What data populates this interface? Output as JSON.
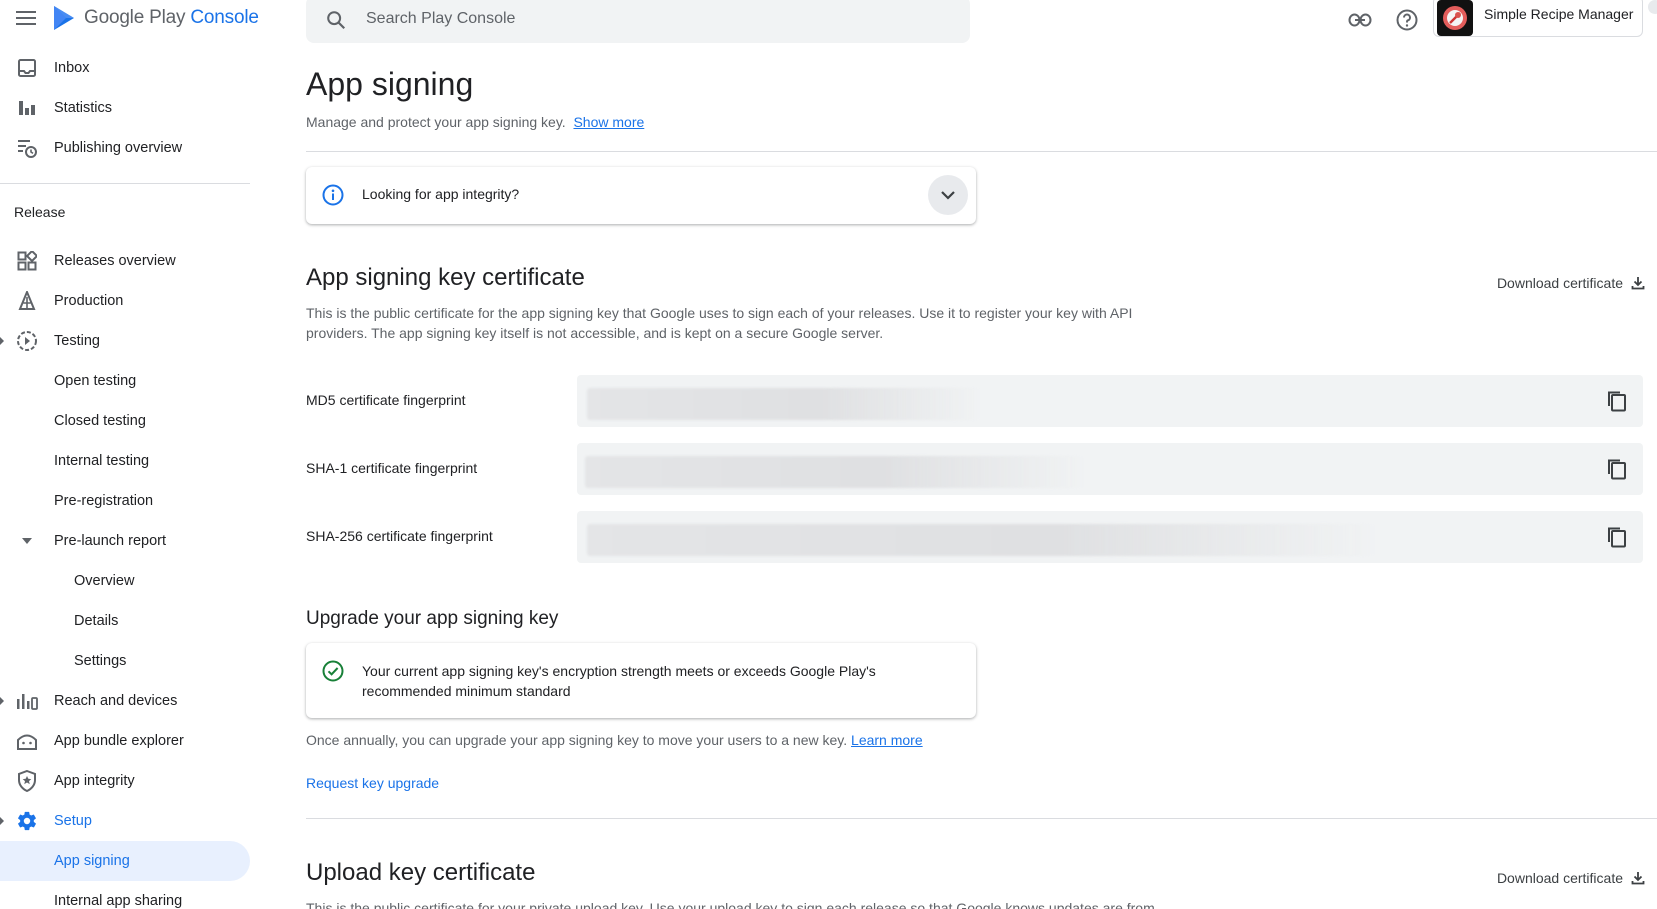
{
  "app": {
    "brand": "Google Play",
    "brand_accent": "Console",
    "accent_color": "#1a73e8"
  },
  "search": {
    "placeholder": "Search Play Console",
    "value": ""
  },
  "account": {
    "name": "Simple Recipe Manager"
  },
  "sidebar": {
    "top_items": [
      {
        "label": "Inbox",
        "icon": "inbox-icon"
      },
      {
        "label": "Statistics",
        "icon": "bar-chart-icon"
      },
      {
        "label": "Publishing overview",
        "icon": "publishing-overview-icon"
      }
    ],
    "section_label": "Release",
    "items": [
      {
        "label": "Releases overview",
        "icon": "dashboard-icon"
      },
      {
        "label": "Production",
        "icon": "production-icon"
      },
      {
        "label": "Testing",
        "icon": "testing-icon"
      },
      {
        "label": "Open testing"
      },
      {
        "label": "Closed testing"
      },
      {
        "label": "Internal testing"
      },
      {
        "label": "Pre-registration"
      },
      {
        "label": "Pre-launch report",
        "icon": "caret-down-icon"
      },
      {
        "label": "Overview"
      },
      {
        "label": "Details"
      },
      {
        "label": "Settings"
      },
      {
        "label": "Reach and devices",
        "icon": "reach-devices-icon"
      },
      {
        "label": "App bundle explorer",
        "icon": "bundle-explorer-icon"
      },
      {
        "label": "App integrity",
        "icon": "shield-icon"
      },
      {
        "label": "Setup",
        "icon": "gear-icon"
      },
      {
        "label": "App signing",
        "active": true
      },
      {
        "label": "Internal app sharing"
      }
    ]
  },
  "main": {
    "title": "App signing",
    "subtitle": "Manage and protect your app signing key.",
    "show_more": "Show more",
    "integrity_card": {
      "text": "Looking for app integrity?"
    },
    "signing_cert": {
      "title": "App signing key certificate",
      "download": "Download certificate",
      "description": "This is the public certificate for the app signing key that Google uses to sign each of your releases. Use it to register your key with API providers. The app signing key itself is not accessible, and is kept on a secure Google server.",
      "fingerprints": [
        {
          "label": "MD5 certificate fingerprint"
        },
        {
          "label": "SHA-1 certificate fingerprint"
        },
        {
          "label": "SHA-256 certificate fingerprint"
        }
      ]
    },
    "upgrade": {
      "title": "Upgrade your app signing key",
      "status": "Your current app signing key's encryption strength meets or exceeds Google Play's recommended minimum standard",
      "note": "Once annually, you can upgrade your app signing key to move your users to a new key.",
      "learn_more": "Learn more",
      "request": "Request key upgrade"
    },
    "upload_cert": {
      "title": "Upload key certificate",
      "download": "Download certificate",
      "description": "This is the public certificate for your private upload key. Use your upload key to sign each release so that Google knows updates are from"
    }
  }
}
